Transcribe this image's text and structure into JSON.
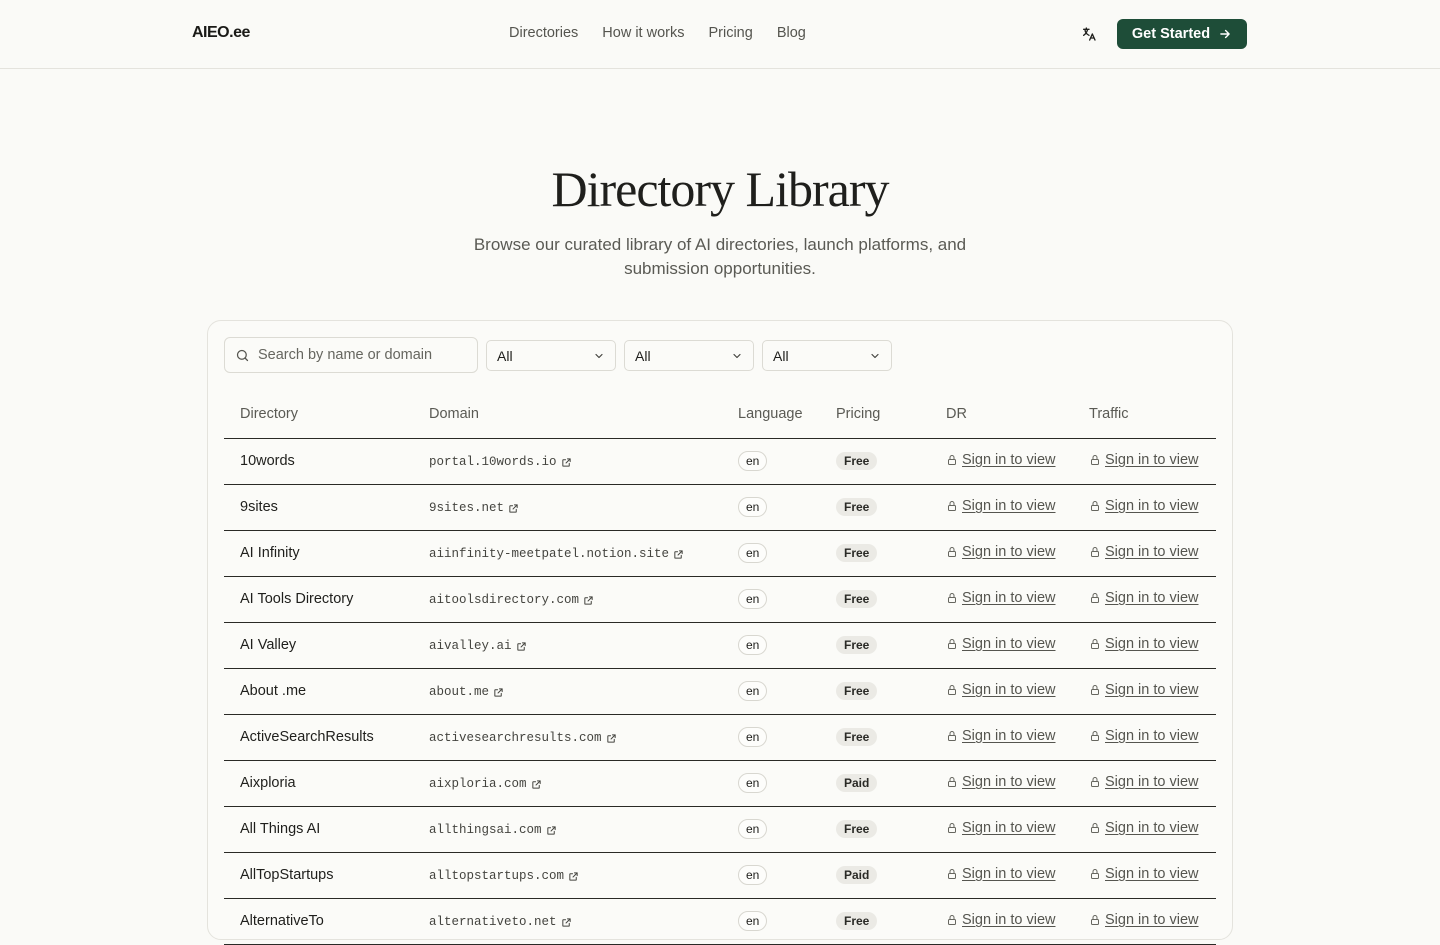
{
  "header": {
    "logo": "AIEO.ee",
    "nav": [
      "Directories",
      "How it works",
      "Pricing",
      "Blog"
    ],
    "cta_label": "Get Started"
  },
  "hero": {
    "title": "Directory Library",
    "subtitle": "Browse our curated library of AI directories, launch platforms, and submission opportunities."
  },
  "filters": {
    "search_placeholder": "Search by name or domain",
    "selects": [
      "All",
      "All",
      "All"
    ]
  },
  "table": {
    "columns": [
      "Directory",
      "Domain",
      "Language",
      "Pricing",
      "DR",
      "Traffic"
    ],
    "locked_label": "Sign in to view",
    "rows": [
      {
        "name": "10words",
        "domain": "portal.10words.io",
        "lang": "en",
        "pricing": "Free"
      },
      {
        "name": "9sites",
        "domain": "9sites.net",
        "lang": "en",
        "pricing": "Free"
      },
      {
        "name": "AI Infinity",
        "domain": "aiinfinity-meetpatel.notion.site",
        "lang": "en",
        "pricing": "Free"
      },
      {
        "name": "AI Tools Directory",
        "domain": "aitoolsdirectory.com",
        "lang": "en",
        "pricing": "Free"
      },
      {
        "name": "AI Valley",
        "domain": "aivalley.ai",
        "lang": "en",
        "pricing": "Free"
      },
      {
        "name": "About .me",
        "domain": "about.me",
        "lang": "en",
        "pricing": "Free"
      },
      {
        "name": "ActiveSearchResults",
        "domain": "activesearchresults.com",
        "lang": "en",
        "pricing": "Free"
      },
      {
        "name": "Aixploria",
        "domain": "aixploria.com",
        "lang": "en",
        "pricing": "Paid"
      },
      {
        "name": "All Things AI",
        "domain": "allthingsai.com",
        "lang": "en",
        "pricing": "Free"
      },
      {
        "name": "AllTopStartups",
        "domain": "alltopstartups.com",
        "lang": "en",
        "pricing": "Paid"
      },
      {
        "name": "AlternativeTo",
        "domain": "alternativeto.net",
        "lang": "en",
        "pricing": "Free"
      }
    ]
  },
  "colors": {
    "accent": "#1e4d38",
    "background": "#fafaf7"
  }
}
